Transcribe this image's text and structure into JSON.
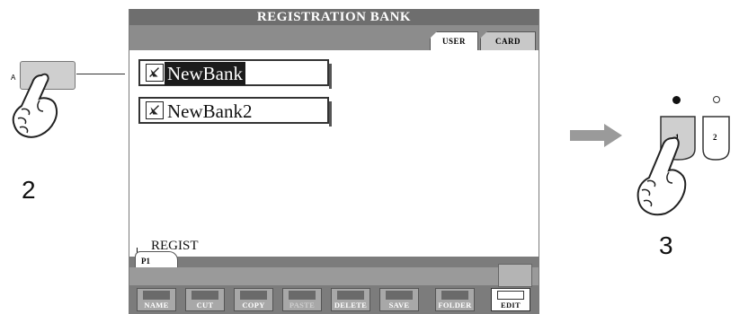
{
  "screen": {
    "title": "REGISTRATION BANK",
    "tabs": [
      {
        "label": "USER",
        "active": true
      },
      {
        "label": "CARD",
        "active": false
      }
    ],
    "banks": [
      {
        "label": "NewBank",
        "selected": true
      },
      {
        "label": "NewBank2",
        "selected": false
      }
    ],
    "regist_label": "REGIST",
    "page_tab": "P1",
    "menu": [
      {
        "label": "NAME",
        "enabled": true
      },
      {
        "label": "CUT",
        "enabled": true
      },
      {
        "label": "COPY",
        "enabled": true
      },
      {
        "label": "PASTE",
        "enabled": false
      },
      {
        "label": "DELETE",
        "enabled": true
      },
      {
        "label": "SAVE",
        "enabled": true
      },
      {
        "label": "FOLDER",
        "enabled": true
      },
      {
        "label": "EDIT",
        "enabled": true,
        "highlighted": true
      }
    ]
  },
  "left_panel": {
    "button_letter": "A",
    "step": "2"
  },
  "right_panel": {
    "buttons": [
      "1",
      "2"
    ],
    "step": "3"
  },
  "colors": {
    "title_bar": "#6e6e6e",
    "menu_band": "#7c7c7c",
    "arrow": "#9a9a9a"
  }
}
